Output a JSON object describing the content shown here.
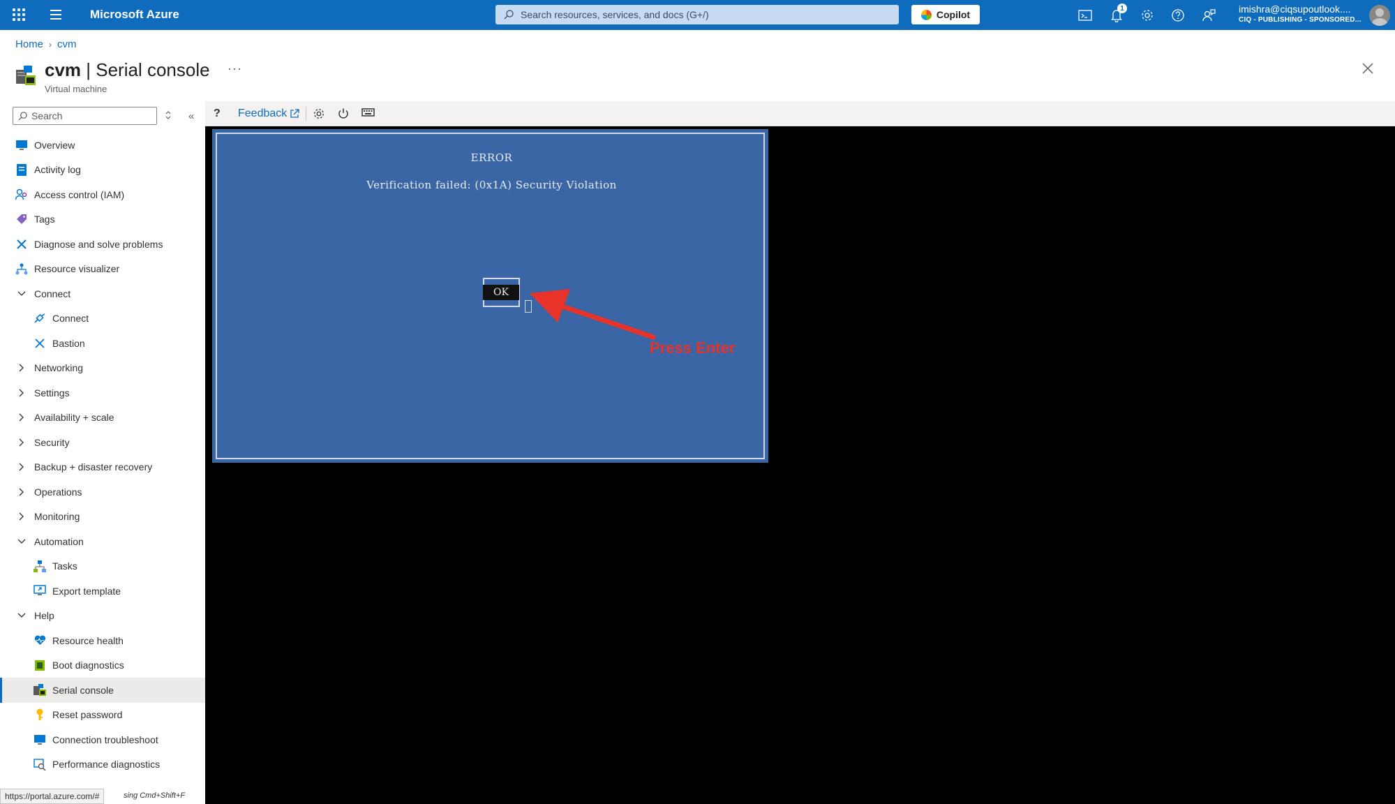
{
  "topbar": {
    "brand": "Microsoft Azure",
    "search_placeholder": "Search resources, services, and docs (G+/)",
    "copilot_label": "Copilot",
    "notifications_count": "1",
    "account_email": "imishra@ciqsupoutlook....",
    "account_tenant": "CIQ - PUBLISHING - SPONSORED..."
  },
  "breadcrumb": {
    "home": "Home",
    "current": "cvm"
  },
  "header": {
    "resource_name": "cvm",
    "title_suffix": " | Serial console",
    "subtitle": "Virtual machine",
    "more": "···"
  },
  "sidebar": {
    "search_placeholder": "Search",
    "collapse": "«",
    "items": [
      {
        "label": "Overview"
      },
      {
        "label": "Activity log"
      },
      {
        "label": "Access control (IAM)"
      },
      {
        "label": "Tags"
      },
      {
        "label": "Diagnose and solve problems"
      },
      {
        "label": "Resource visualizer"
      },
      {
        "label": "Connect"
      },
      {
        "label": "Connect"
      },
      {
        "label": "Bastion"
      },
      {
        "label": "Networking"
      },
      {
        "label": "Settings"
      },
      {
        "label": "Availability + scale"
      },
      {
        "label": "Security"
      },
      {
        "label": "Backup + disaster recovery"
      },
      {
        "label": "Operations"
      },
      {
        "label": "Monitoring"
      },
      {
        "label": "Automation"
      },
      {
        "label": "Tasks"
      },
      {
        "label": "Export template"
      },
      {
        "label": "Help"
      },
      {
        "label": "Resource health"
      },
      {
        "label": "Boot diagnostics"
      },
      {
        "label": "Serial console"
      },
      {
        "label": "Reset password"
      },
      {
        "label": "Connection troubleshoot"
      },
      {
        "label": "Performance diagnostics"
      }
    ]
  },
  "toolbar": {
    "help": "?",
    "feedback": "Feedback"
  },
  "console": {
    "dialog_title": "ERROR",
    "dialog_message": "Verification failed: (0x1A) Security Violation",
    "ok_label": "OK",
    "annotation": "Press Enter"
  },
  "status": {
    "url": "https://portal.azure.com/#",
    "hint": "sing Cmd+Shift+F"
  },
  "colors": {
    "azure_blue": "#0f6cbd",
    "console_blue": "#3a66a6",
    "annotation_red": "#e8332a"
  }
}
